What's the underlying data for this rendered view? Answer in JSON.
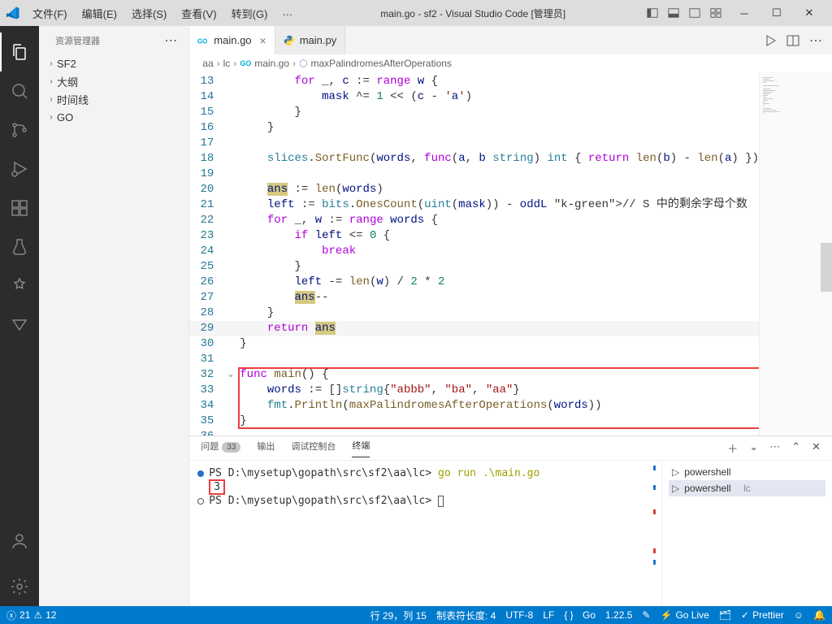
{
  "title": "main.go - sf2 - Visual Studio Code [管理员]",
  "menu": {
    "file": "文件(F)",
    "edit": "编辑(E)",
    "select": "选择(S)",
    "view": "查看(V)",
    "goto": "转到(G)",
    "more": "…"
  },
  "sidebar": {
    "header": "资源管理器",
    "items": [
      {
        "label": "SF2"
      },
      {
        "label": "大纲"
      },
      {
        "label": "时间线"
      },
      {
        "label": "GO"
      }
    ]
  },
  "tabs": [
    {
      "label": "main.go",
      "lang": "go",
      "active": true
    },
    {
      "label": "main.py",
      "lang": "py",
      "active": false
    }
  ],
  "breadcrumbs": {
    "p1": "aa",
    "p2": "lc",
    "p3": "main.go",
    "p4": "maxPalindromesAfterOperations"
  },
  "code": {
    "lines": [
      {
        "n": "13",
        "t": "        for _, c := range w {"
      },
      {
        "n": "14",
        "t": "            mask ^= 1 << (c - 'a')"
      },
      {
        "n": "15",
        "t": "        }"
      },
      {
        "n": "16",
        "t": "    }"
      },
      {
        "n": "17",
        "t": ""
      },
      {
        "n": "18",
        "t": "    slices.SortFunc(words, func(a, b string) int { return len(b) - len(a) })"
      },
      {
        "n": "19",
        "t": ""
      },
      {
        "n": "20",
        "t": "    ans := len(words)"
      },
      {
        "n": "21",
        "t": "    left := bits.OnesCount(uint(mask)) - oddL // S 中的剩余字母个数"
      },
      {
        "n": "22",
        "t": "    for _, w := range words {"
      },
      {
        "n": "23",
        "t": "        if left <= 0 {"
      },
      {
        "n": "24",
        "t": "            break"
      },
      {
        "n": "25",
        "t": "        }"
      },
      {
        "n": "26",
        "t": "        left -= len(w) / 2 * 2"
      },
      {
        "n": "27",
        "t": "        ans--"
      },
      {
        "n": "28",
        "t": "    }"
      },
      {
        "n": "29",
        "t": "    return ans"
      },
      {
        "n": "30",
        "t": "}"
      },
      {
        "n": "31",
        "t": ""
      },
      {
        "n": "32",
        "t": "func main() {"
      },
      {
        "n": "33",
        "t": "    words := []string{\"abbb\", \"ba\", \"aa\"}"
      },
      {
        "n": "34",
        "t": "    fmt.Println(maxPalindromesAfterOperations(words))"
      },
      {
        "n": "35",
        "t": "}"
      },
      {
        "n": "36",
        "t": ""
      }
    ]
  },
  "panel": {
    "tabs": {
      "problems": "问题",
      "problems_count": "33",
      "output": "输出",
      "debug": "调试控制台",
      "terminal": "终端"
    },
    "terminal": {
      "prompt1_path": "PS D:\\mysetup\\gopath\\src\\sf2\\aa\\lc>",
      "cmd1": "go run .\\main.go",
      "output1": "3",
      "prompt2_path": "PS D:\\mysetup\\gopath\\src\\sf2\\aa\\lc>"
    },
    "term_list": {
      "t1": "powershell",
      "t2": "powershell",
      "t2_tag": "lc"
    }
  },
  "status": {
    "errors": "21",
    "warnings": "12",
    "ln_col": "行 29，列 15",
    "tab": "制表符长度: 4",
    "encoding": "UTF-8",
    "eol": "LF",
    "lang": "Go",
    "ver": "1.22.5",
    "golive": "Go Live",
    "prettier": "Prettier"
  }
}
